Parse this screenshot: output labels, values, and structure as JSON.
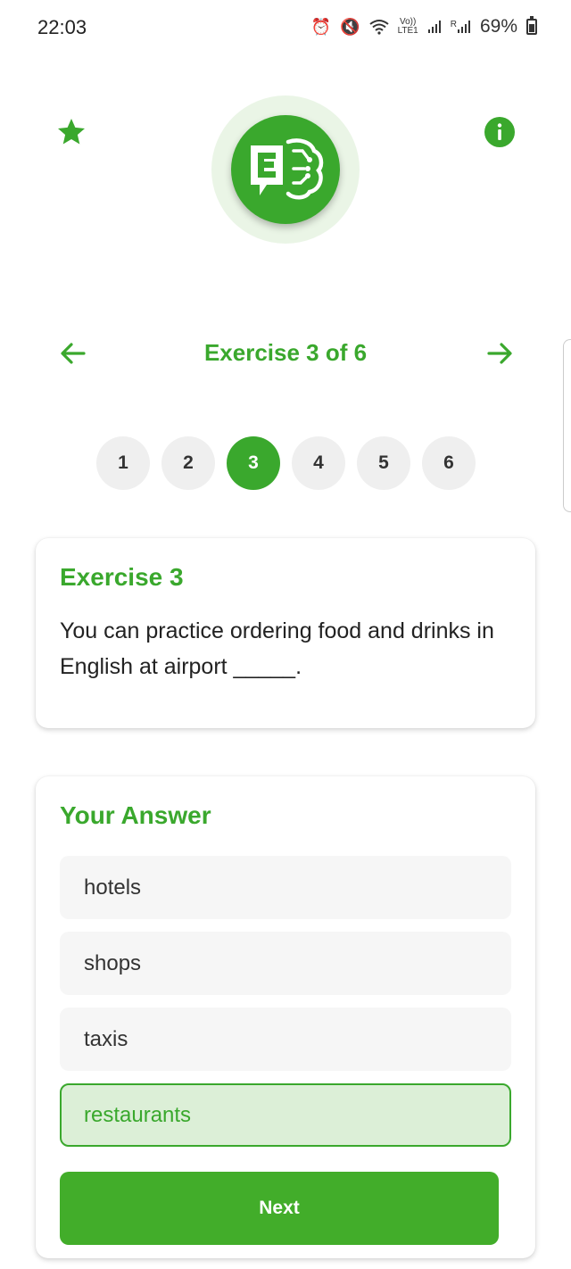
{
  "status_bar": {
    "time": "22:03",
    "volte_top": "Vo))",
    "volte_bottom": "LTE1",
    "roaming": "R",
    "battery": "69%"
  },
  "header": {
    "logo_icon": "english-brain-logo-icon",
    "favorite_icon": "star-icon",
    "info_icon": "info-icon"
  },
  "navigation": {
    "title": "Exercise 3 of 6",
    "prev_icon": "arrow-left-icon",
    "next_icon": "arrow-right-icon"
  },
  "pager": {
    "pages": [
      "1",
      "2",
      "3",
      "4",
      "5",
      "6"
    ],
    "active": "3"
  },
  "exercise": {
    "title": "Exercise 3",
    "text": "You can practice ordering food and drinks in English at airport _____."
  },
  "answer": {
    "title": "Your Answer",
    "options": [
      "hotels",
      "shops",
      "taxis",
      "restaurants"
    ],
    "selected": "restaurants"
  },
  "next_button": "Next",
  "colors": {
    "accent": "#3aa82d",
    "selected_bg": "#dcefd7",
    "option_bg": "#f6f6f6",
    "pager_bg": "#efefef"
  }
}
